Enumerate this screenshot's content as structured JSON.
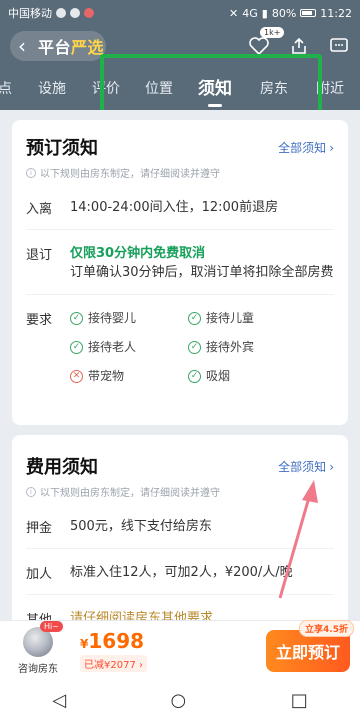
{
  "status_bar": {
    "carrier": "中国移动",
    "network": "4G",
    "battery": "80%",
    "time": "11:22"
  },
  "nav": {
    "brand_left": "平台",
    "brand_highlight": "严选",
    "favorite_count": "1k+"
  },
  "tabs": [
    {
      "label": "点",
      "left": "0"
    },
    {
      "label": "设施"
    },
    {
      "label": "评价"
    },
    {
      "label": "位置"
    },
    {
      "label": "须知"
    },
    {
      "label": "房东"
    },
    {
      "label": "附近"
    }
  ],
  "booking_notice": {
    "title": "预订须知",
    "see_all": "全部须知",
    "subtitle": "以下规则由房东制定，请仔细阅读并遵守",
    "checkin_label": "入离",
    "checkin_value": "14:00-24:00间入住，12:00前退房",
    "cancel_label": "退订",
    "cancel_highlight": "仅限30分钟内免费取消",
    "cancel_detail": "订单确认30分钟后，取消订单将扣除全部房费",
    "requirements_label": "要求",
    "requirements": [
      {
        "text": "接待婴儿",
        "allowed": true
      },
      {
        "text": "接待儿童",
        "allowed": true
      },
      {
        "text": "接待老人",
        "allowed": true
      },
      {
        "text": "接待外宾",
        "allowed": true
      },
      {
        "text": "带宠物",
        "allowed": false
      },
      {
        "text": "吸烟",
        "allowed": true
      }
    ]
  },
  "fee_notice": {
    "title": "费用须知",
    "see_all": "全部须知",
    "subtitle": "以下规则由房东制定，请仔细阅读并遵守",
    "deposit_label": "押金",
    "deposit_value": "500元，线下支付给房东",
    "extra_label": "加人",
    "extra_value": "标准入住12人，可加2人，¥200/人/晚",
    "other_label": "其他",
    "other_value": "请仔细阅读房东其他要求"
  },
  "bottom_bar": {
    "contact_label": "咨询房东",
    "hi_badge": "Hi~",
    "currency": "¥",
    "price": "1698",
    "discount": "已减¥2077 ›",
    "book_label": "立即预订",
    "book_tag": "立享4.5折"
  },
  "colors": {
    "header": "#596a78",
    "accent_green": "#17a05a",
    "link_blue": "#3f6fc2",
    "cta_orange": "#ff6a00",
    "highlight_box": "#21b14b",
    "arrow": "#f07a8a"
  }
}
